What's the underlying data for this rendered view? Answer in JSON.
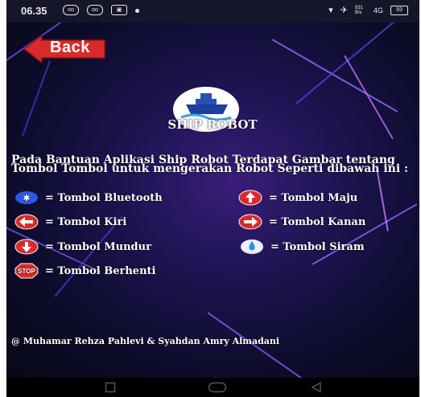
{
  "status_bar": {
    "time": "06.35",
    "notif_icons": [
      "link-icon",
      "link-icon",
      "whatsapp-icon"
    ],
    "network_speed": "931\nB/s",
    "signal_label": "4G",
    "battery": "93"
  },
  "header": {
    "back_label": "Back"
  },
  "app": {
    "title": "SHIP ROBOT",
    "logo_icon": "ship-icon"
  },
  "intro_text": "Pada Bantuan Aplikasi Ship Robot Terdapat Gambar tentang Tombol Tombol untuk mengerakan Robot Seperti dibawah ini :",
  "legend": [
    {
      "icon": "bluetooth-icon",
      "label": "= Tombol Bluetooth"
    },
    {
      "icon": "arrow-up-icon",
      "label": "= Tombol Maju"
    },
    {
      "icon": "arrow-left-icon",
      "label": "= Tombol Kiri"
    },
    {
      "icon": "arrow-right-icon",
      "label": "= Tombol Kanan"
    },
    {
      "icon": "arrow-down-icon",
      "label": "= Tombol Mundur"
    },
    {
      "icon": "water-drop-icon",
      "label": "= Tombol Siram"
    },
    {
      "icon": "stop-sign-icon",
      "label": "= Tombol Berhenti"
    }
  ],
  "footer_text": "@ Muhamar Rehza Pahlevi &  Syahdan Amry Almadani",
  "colors": {
    "accent_red": "#d92a2a",
    "bluetooth_blue": "#2b58e6",
    "background": "#1c1450"
  }
}
